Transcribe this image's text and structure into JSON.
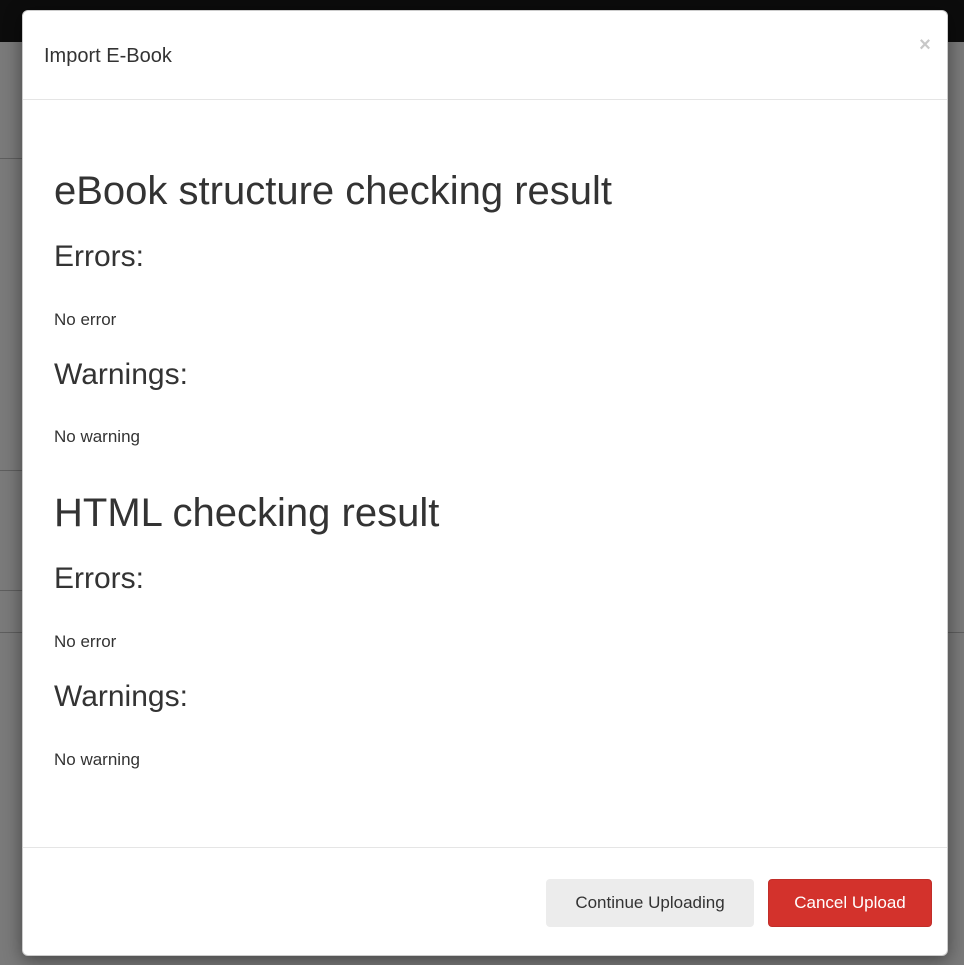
{
  "modal": {
    "title": "Import E-Book",
    "close_label": "×",
    "ebook_section": {
      "heading": "eBook structure checking result",
      "errors_heading": "Errors:",
      "errors_text": "No error",
      "warnings_heading": "Warnings:",
      "warnings_text": "No warning"
    },
    "html_section": {
      "heading": "HTML checking result",
      "errors_heading": "Errors:",
      "errors_text": "No error",
      "warnings_heading": "Warnings:",
      "warnings_text": "No warning"
    },
    "footer": {
      "continue_label": "Continue Uploading",
      "cancel_label": "Cancel Upload"
    }
  },
  "colors": {
    "cancel_button": "#d3322c",
    "continue_button": "#ececec",
    "overlay": "#777777",
    "topbar": "#0c0c0c"
  }
}
